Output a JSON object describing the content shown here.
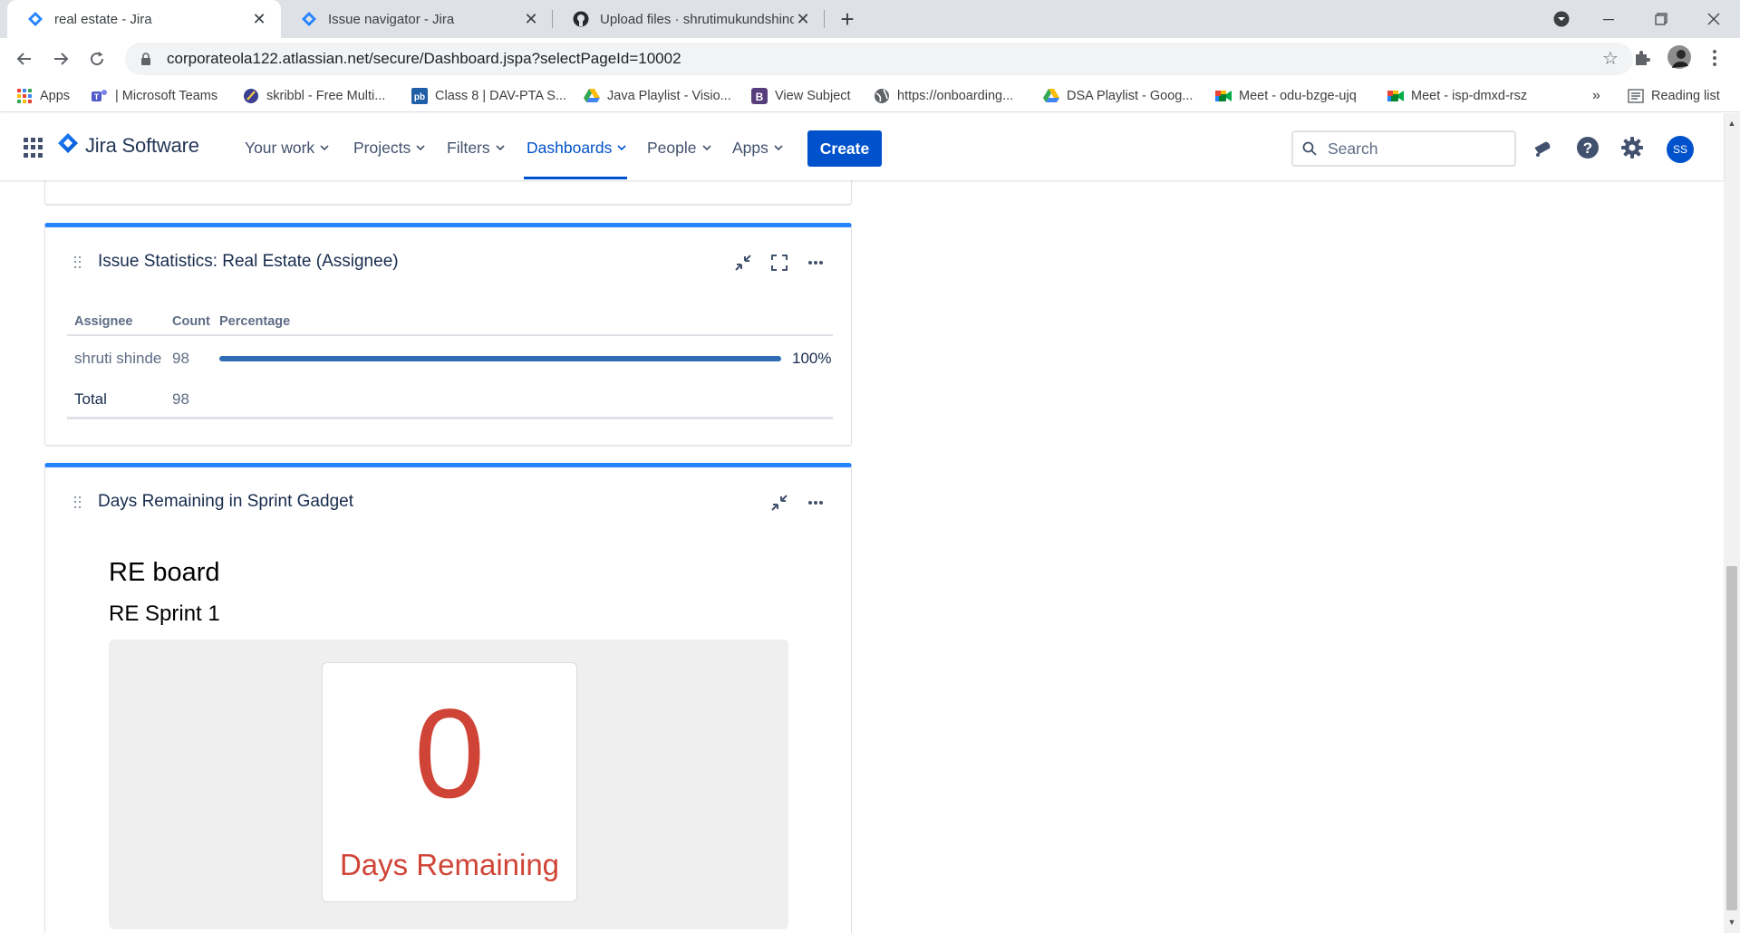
{
  "browser": {
    "tabs": [
      {
        "title": "real estate - Jira",
        "active": true,
        "icon": "jira-icon"
      },
      {
        "title": "Issue navigator - Jira",
        "active": false,
        "icon": "jira-icon"
      },
      {
        "title": "Upload files · shrutimukundshinde",
        "active": false,
        "icon": "github-icon"
      }
    ],
    "url": "corporateola122.atlassian.net/secure/Dashboard.jspa?selectPageId=10002",
    "bookmarks": [
      {
        "label": "Apps",
        "icon": "apps-grid-icon"
      },
      {
        "label": "| Microsoft Teams",
        "icon": "teams-icon"
      },
      {
        "label": "skribbl - Free Multi...",
        "icon": "skribbl-icon"
      },
      {
        "label": "Class 8 | DAV-PTA S...",
        "icon": "pb-icon"
      },
      {
        "label": "Java Playlist - Visio...",
        "icon": "drive-icon"
      },
      {
        "label": "View Subject",
        "icon": "b-icon"
      },
      {
        "label": "https://onboarding...",
        "icon": "globe-icon"
      },
      {
        "label": "DSA Playlist - Goog...",
        "icon": "drive-icon"
      },
      {
        "label": "Meet - odu-bzge-ujq",
        "icon": "meet-icon"
      },
      {
        "label": "Meet - isp-dmxd-rsz",
        "icon": "meet-icon"
      }
    ],
    "bookmarks_more": "»",
    "reading_list": "Reading list"
  },
  "jira": {
    "product": "Jira Software",
    "nav": [
      {
        "label": "Your work",
        "selected": false
      },
      {
        "label": "Projects",
        "selected": false
      },
      {
        "label": "Filters",
        "selected": false
      },
      {
        "label": "Dashboards",
        "selected": true
      },
      {
        "label": "People",
        "selected": false
      },
      {
        "label": "Apps",
        "selected": false
      }
    ],
    "create_label": "Create",
    "search_placeholder": "Search",
    "avatar_initials": "SS"
  },
  "issue_stats": {
    "title": "Issue Statistics: Real Estate (Assignee)",
    "columns": [
      "Assignee",
      "Count",
      "Percentage"
    ],
    "rows": [
      {
        "assignee": "shruti shinde",
        "count": "98",
        "percentage_label": "100%",
        "percentage": 100
      }
    ],
    "total_label": "Total",
    "total_count": "98"
  },
  "sprint_gadget": {
    "title": "Days Remaining in Sprint Gadget",
    "board": "RE board",
    "sprint": "RE Sprint 1",
    "days_remaining": "0",
    "days_label": "Days Remaining"
  },
  "colors": {
    "brand": "#0052cc",
    "gadget_accent": "#2684ff",
    "days_red": "#d04437",
    "progress": "#2f6db5"
  }
}
